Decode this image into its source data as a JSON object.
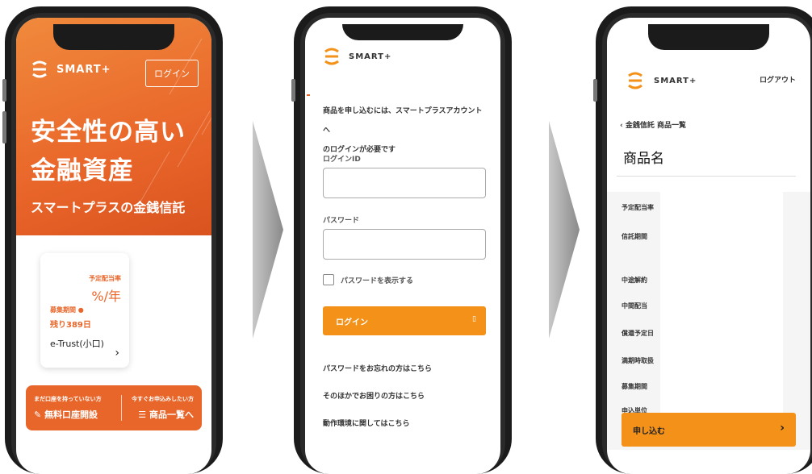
{
  "phone1": {
    "logo_text": "SMART+",
    "login_button": "ログイン",
    "hero_title_line1": "安全性の高い",
    "hero_title_line2": "金融資産",
    "hero_subtitle": "スマートプラスの金銭信託",
    "card": {
      "rate_label": "予定配当率",
      "rate_value": "%/年",
      "period_label": "募集期間",
      "remaining": "残り389日",
      "product": "e-Trust(小口)"
    },
    "bottom": {
      "left_small": "まだ口座を持っていない方",
      "left_big": "無料口座開設",
      "right_small": "今すぐお申込みしたい方",
      "right_big": "商品一覧へ"
    }
  },
  "phone2": {
    "logo_text": "SMART+",
    "notice_line1": "商品を申し込むには、スマートプラスアカウントへ",
    "notice_line2": "のログインが必要です",
    "login_id_label": "ログインID",
    "password_label": "パスワード",
    "show_password_label": "パスワードを表示する",
    "login_button": "ログイン",
    "forgot_link": "パスワードをお忘れの方はこちら",
    "other_link": "そのほかでお困りの方はこちら",
    "env_link": "動作環境に関してはこちら"
  },
  "phone3": {
    "logo_text": "SMART+",
    "logout": "ログアウト",
    "breadcrumb": "金銭信託 商品一覧",
    "product_name": "商品名",
    "rows": [
      "予定配当率",
      "信託期間",
      "中途解約",
      "中間配当",
      "償還予定日",
      "満期時取扱",
      "募集期間",
      "申込単位"
    ],
    "apply_button": "申し込む"
  },
  "colors": {
    "orange": "#e9662a",
    "button_orange": "#f39118"
  }
}
